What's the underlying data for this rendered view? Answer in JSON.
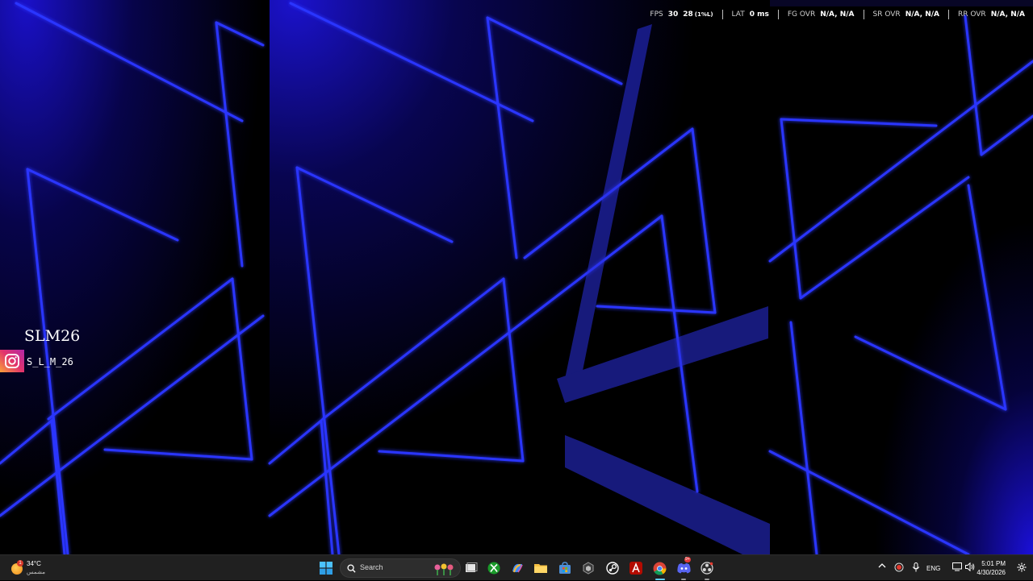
{
  "overlay": {
    "fps_label": "FPS",
    "fps_value": "30",
    "fps_low": "28",
    "fps_low_label": "(1%L)",
    "lat_label": "LAT",
    "lat_value": "0 ms",
    "fg_label": "FG OVR",
    "fg_value": "N/A, N/A",
    "sr_label": "SR OVR",
    "sr_value": "N/A, N/A",
    "rr_label": "RR OVR",
    "rr_value": "N/A, N/A"
  },
  "branding": {
    "name": "SLM26",
    "instagram_handle": "S_L_M_26",
    "instagram_icon": "instagram-icon"
  },
  "colors": {
    "neon": "#2633ff",
    "taskbar": "#202020",
    "accent": "#60cdff"
  },
  "taskbar": {
    "weather": {
      "temp": "34°C",
      "desc": "مشمس",
      "badge": "1",
      "icon": "sun-icon"
    },
    "search": {
      "label": "Search"
    },
    "apps": [
      "start-icon",
      "task-view-icon",
      "xbox-icon",
      "copilot-icon",
      "file-explorer-icon",
      "microsoft-store-icon",
      "app-icon",
      "steam-icon",
      "adobe-icon",
      "chrome-icon",
      "discord-icon",
      "obs-icon"
    ],
    "discord_badge": "9+",
    "tray": {
      "language": "ENG",
      "time": "5:01 PM",
      "date": "4/30/2026"
    }
  }
}
